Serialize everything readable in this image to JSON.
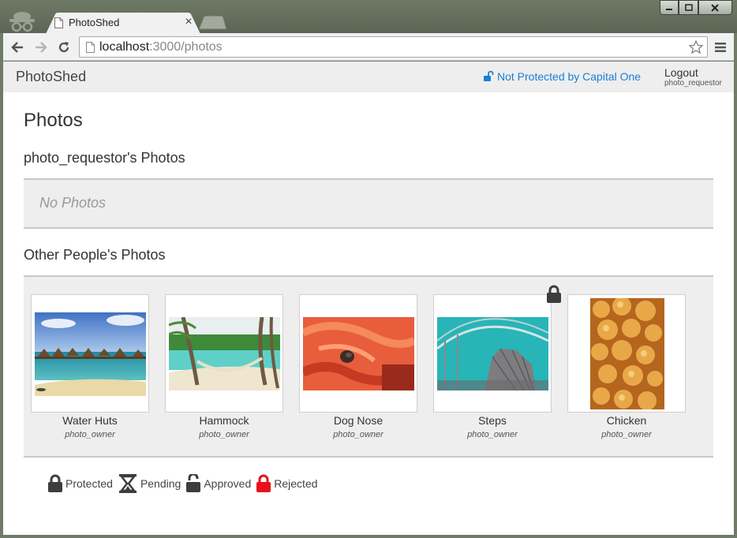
{
  "browser": {
    "tab_title": "PhotoShed",
    "tab_close": "×",
    "url_host": "localhost",
    "url_rest": ":3000/photos"
  },
  "navbar": {
    "brand": "PhotoShed",
    "protection_link": "Not Protected by Capital One",
    "logout": "Logout",
    "username": "photo_requestor"
  },
  "main": {
    "title": "Photos",
    "my_photos_heading": "photo_requestor's Photos",
    "no_photos": "No Photos",
    "others_heading": "Other People's Photos",
    "photos": [
      {
        "title": "Water Huts",
        "owner": "photo_owner",
        "locked": false
      },
      {
        "title": "Hammock",
        "owner": "photo_owner",
        "locked": false
      },
      {
        "title": "Dog Nose",
        "owner": "photo_owner",
        "locked": false
      },
      {
        "title": "Steps",
        "owner": "photo_owner",
        "locked": true
      },
      {
        "title": "Chicken",
        "owner": "photo_owner",
        "locked": false
      }
    ]
  },
  "legend": {
    "protected": "Protected",
    "pending": "Pending",
    "approved": "Approved",
    "rejected": "Rejected"
  },
  "colors": {
    "link": "#1a7fd6",
    "rejected": "#e8101a",
    "lock": "#444444"
  }
}
